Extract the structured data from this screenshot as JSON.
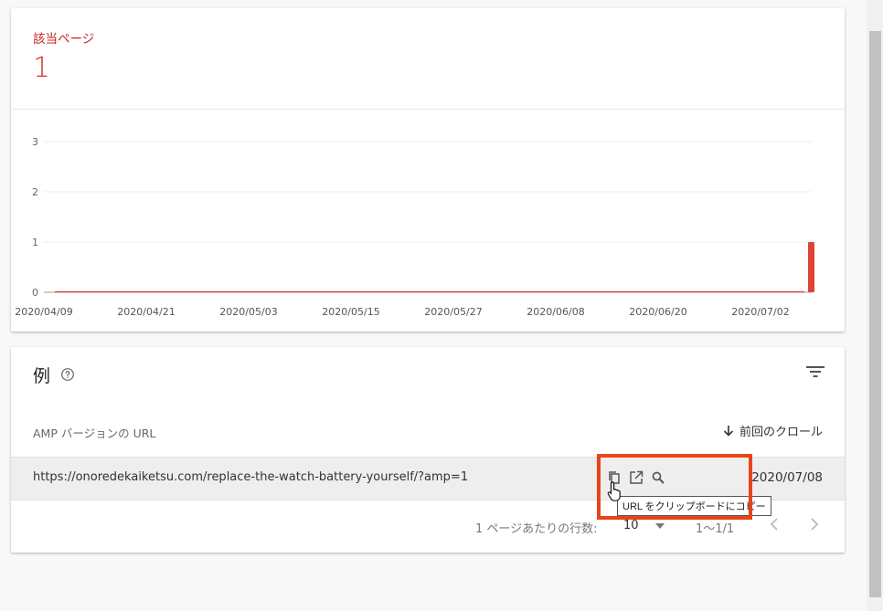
{
  "summary": {
    "label": "該当ページ",
    "value": "1"
  },
  "chart_data": {
    "type": "bar",
    "title": "",
    "xlabel": "",
    "ylabel": "",
    "ylim": [
      0,
      3
    ],
    "yticks": [
      "0",
      "1",
      "2",
      "3"
    ],
    "xticks": [
      "2020/04/09",
      "2020/04/21",
      "2020/05/03",
      "2020/05/15",
      "2020/05/27",
      "2020/06/08",
      "2020/06/20",
      "2020/07/02"
    ],
    "start_date": "2020-04-09",
    "end_date": "2020-07-08",
    "values": [
      {
        "date": "2020-07-08",
        "value": 1
      }
    ],
    "color": "#db4437",
    "grid": true
  },
  "examples": {
    "title": "例",
    "column_url": "AMP バージョンの URL",
    "column_crawl": "前回のクロール",
    "rows": [
      {
        "url": "https://onoredekaiketsu.com/replace-the-watch-battery-yourself/?amp=1",
        "date": "2020/07/08"
      }
    ],
    "tooltip": "URL をクリップボードにコピー",
    "pagination": {
      "label": "1 ページあたりの行数:",
      "size": "10",
      "range": "1〜1/1"
    }
  },
  "colors": {
    "accent": "#d93025",
    "highlight": "#e8441a"
  }
}
